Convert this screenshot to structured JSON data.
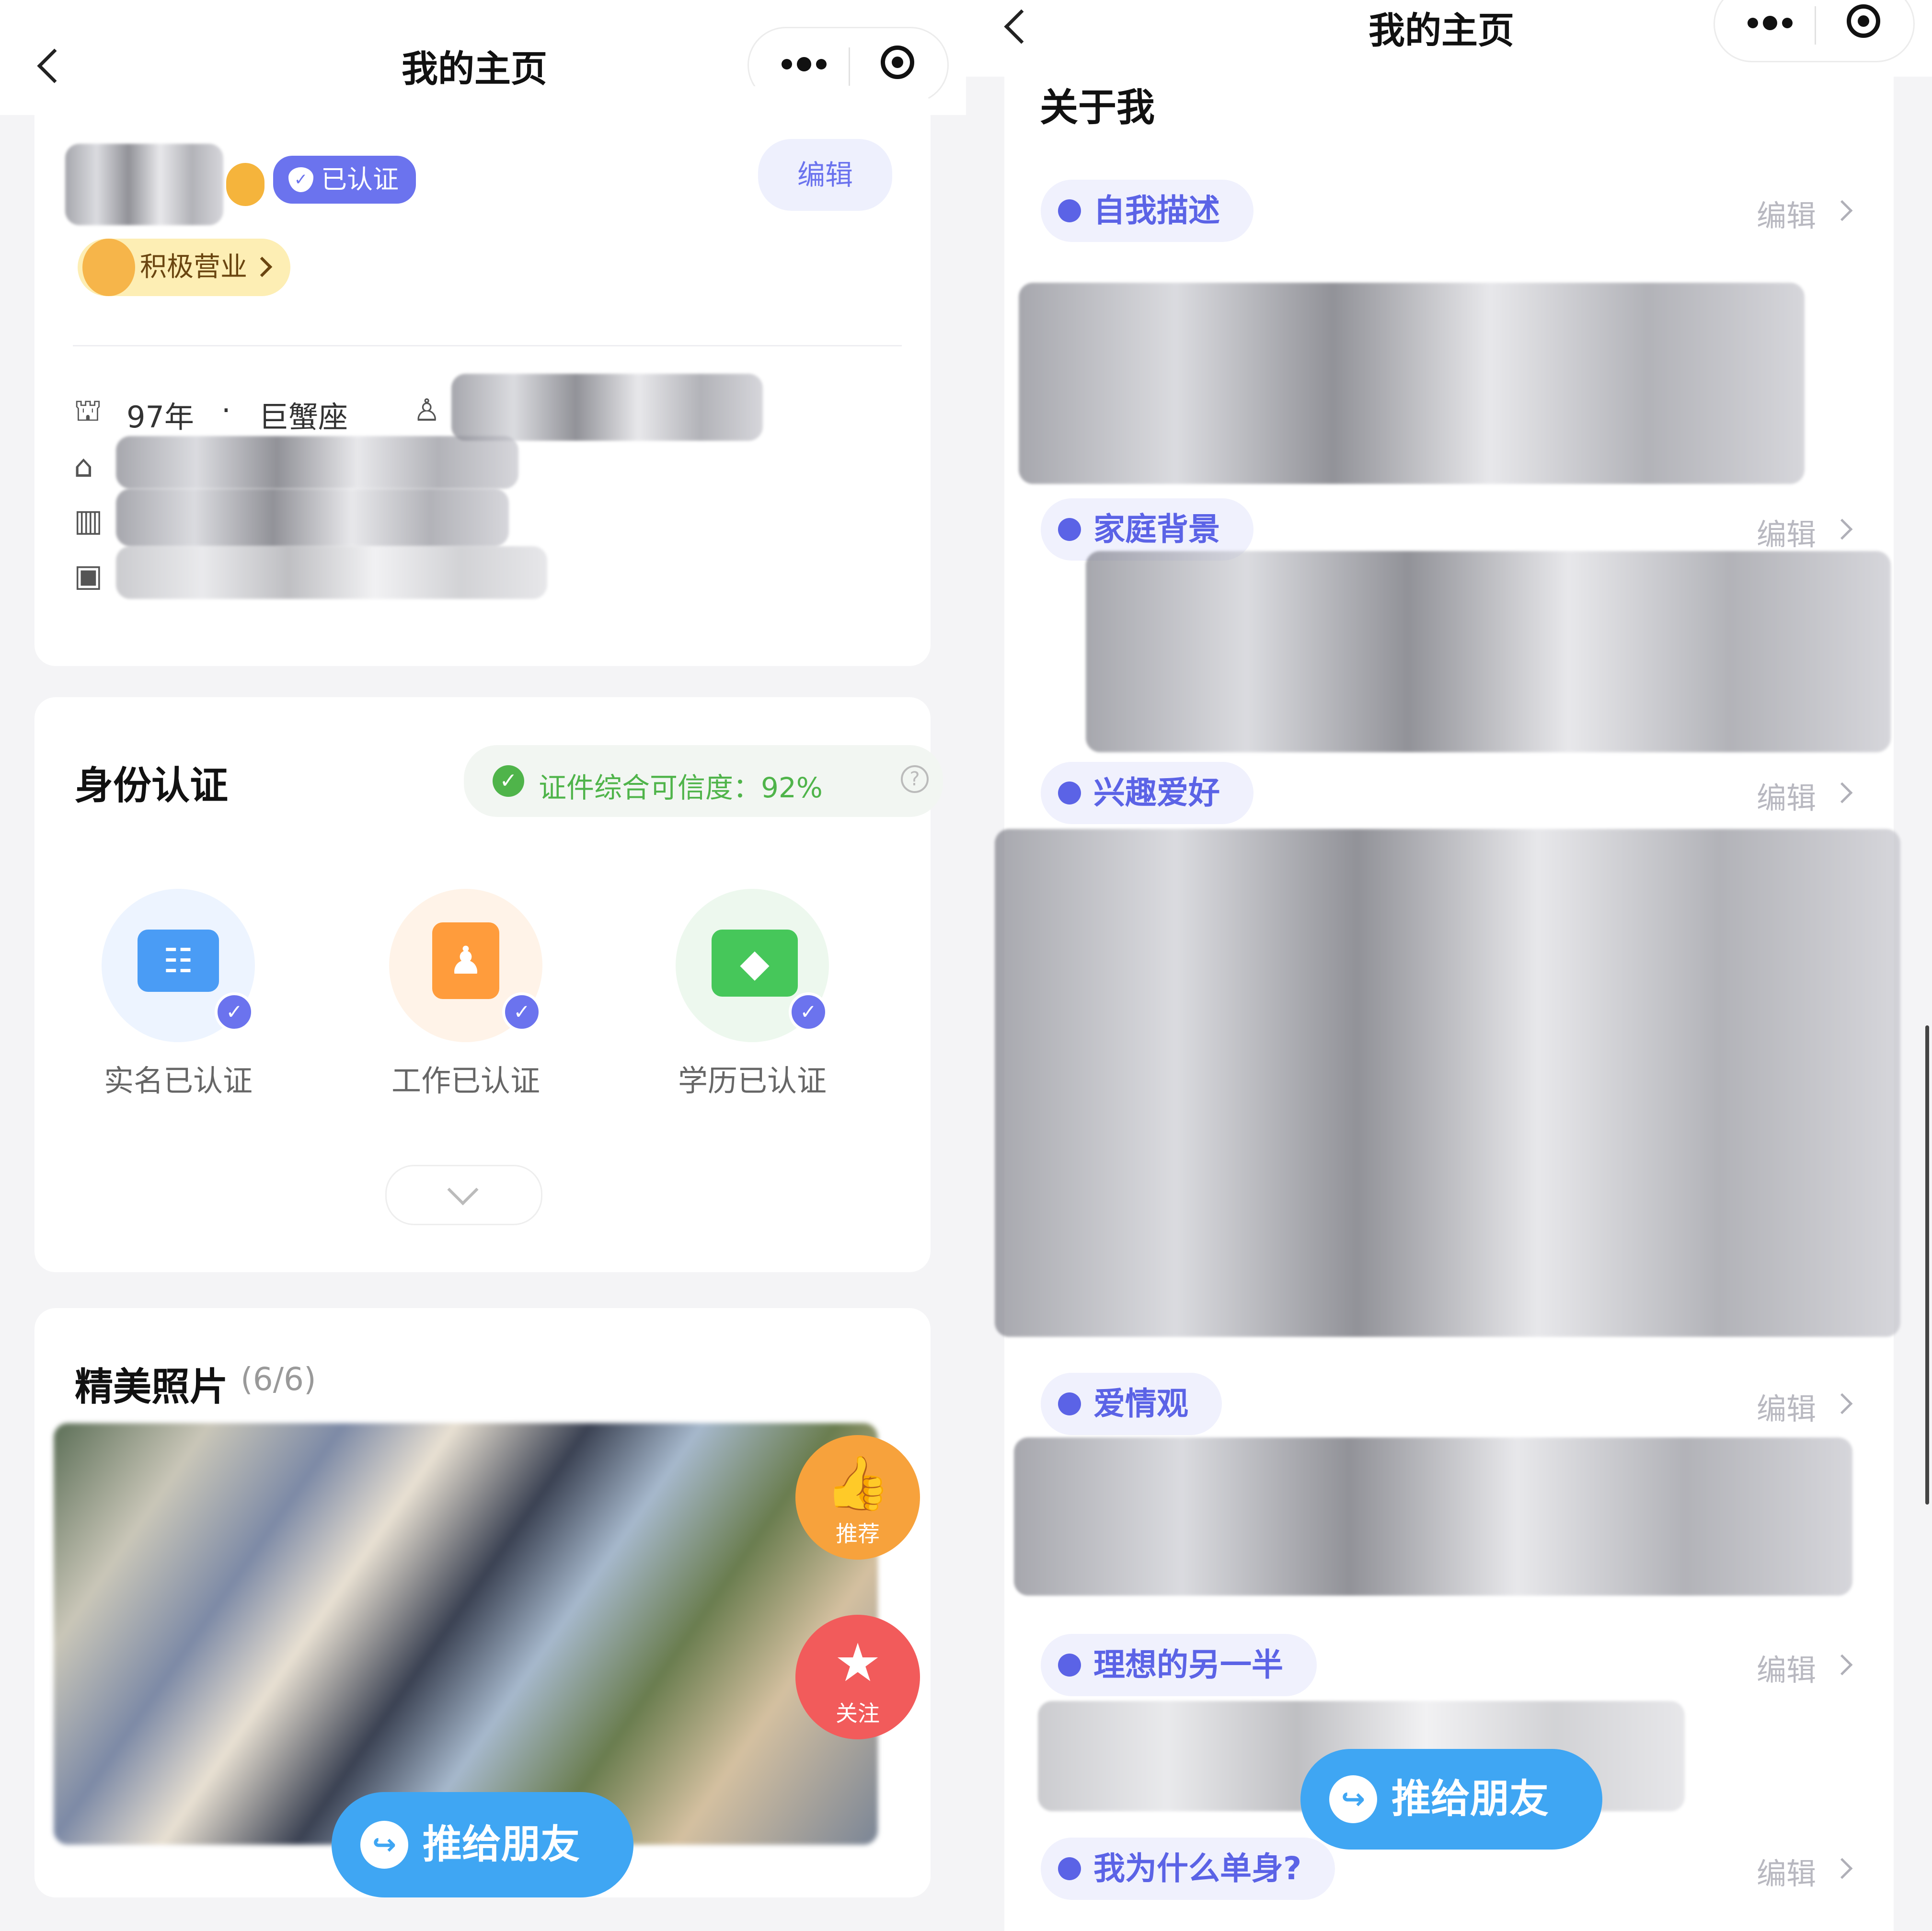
{
  "left": {
    "header": {
      "title": "我的主页"
    },
    "profile": {
      "verified_badge": "已认证",
      "active_tag": "积极营业",
      "edit_label": "编辑",
      "birth_year": "97年",
      "dot": "·",
      "zodiac": "巨蟹座"
    },
    "identity": {
      "title": "身份认证",
      "trust_text": "证件综合可信度：92%",
      "trust_percent": 92,
      "items": [
        {
          "label": "实名已认证",
          "icon": "id-card-icon",
          "color": "#4a9cf5"
        },
        {
          "label": "工作已认证",
          "icon": "work-badge-icon",
          "color": "#ff9c3c"
        },
        {
          "label": "学历已认证",
          "icon": "graduation-cap-icon",
          "color": "#46c75a"
        }
      ]
    },
    "photos": {
      "title": "精美照片",
      "count": "(6/6)"
    },
    "actions": {
      "recommend": "推荐",
      "follow": "关注",
      "share": "推给朋友"
    }
  },
  "right": {
    "header": {
      "title": "我的主页"
    },
    "about": {
      "title": "关于我",
      "edit_label": "编辑",
      "sections": [
        "自我描述",
        "家庭背景",
        "兴趣爱好",
        "爱情观",
        "理想的另一半",
        "我为什么单身?"
      ]
    },
    "share": "推给朋友"
  },
  "colors": {
    "accent": "#6b73ee",
    "share_blue": "#3fa6f3",
    "recommend_orange": "#f7a23c",
    "follow_red": "#f25b5b",
    "trust_green": "#4fb44a"
  }
}
